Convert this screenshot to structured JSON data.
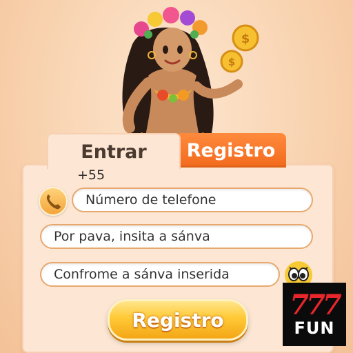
{
  "tabs": {
    "login_label": "Entrar",
    "register_label": "Registro",
    "active": "register"
  },
  "form": {
    "country_code": "+55",
    "phone_placeholder": "Número de telefone",
    "password_placeholder": "Por pava, insita a sánva",
    "confirm_placeholder": "Confrome a sánva inserida"
  },
  "submit_label": "Registro",
  "brand": {
    "logo_number": "777",
    "logo_word": "FUN"
  },
  "colors": {
    "accent": "#f26a1c",
    "button_gold": "#ffc935",
    "background": "#f8d1ad"
  },
  "icons": {
    "phone": "phone-icon",
    "eyes": "eyes-icon"
  }
}
